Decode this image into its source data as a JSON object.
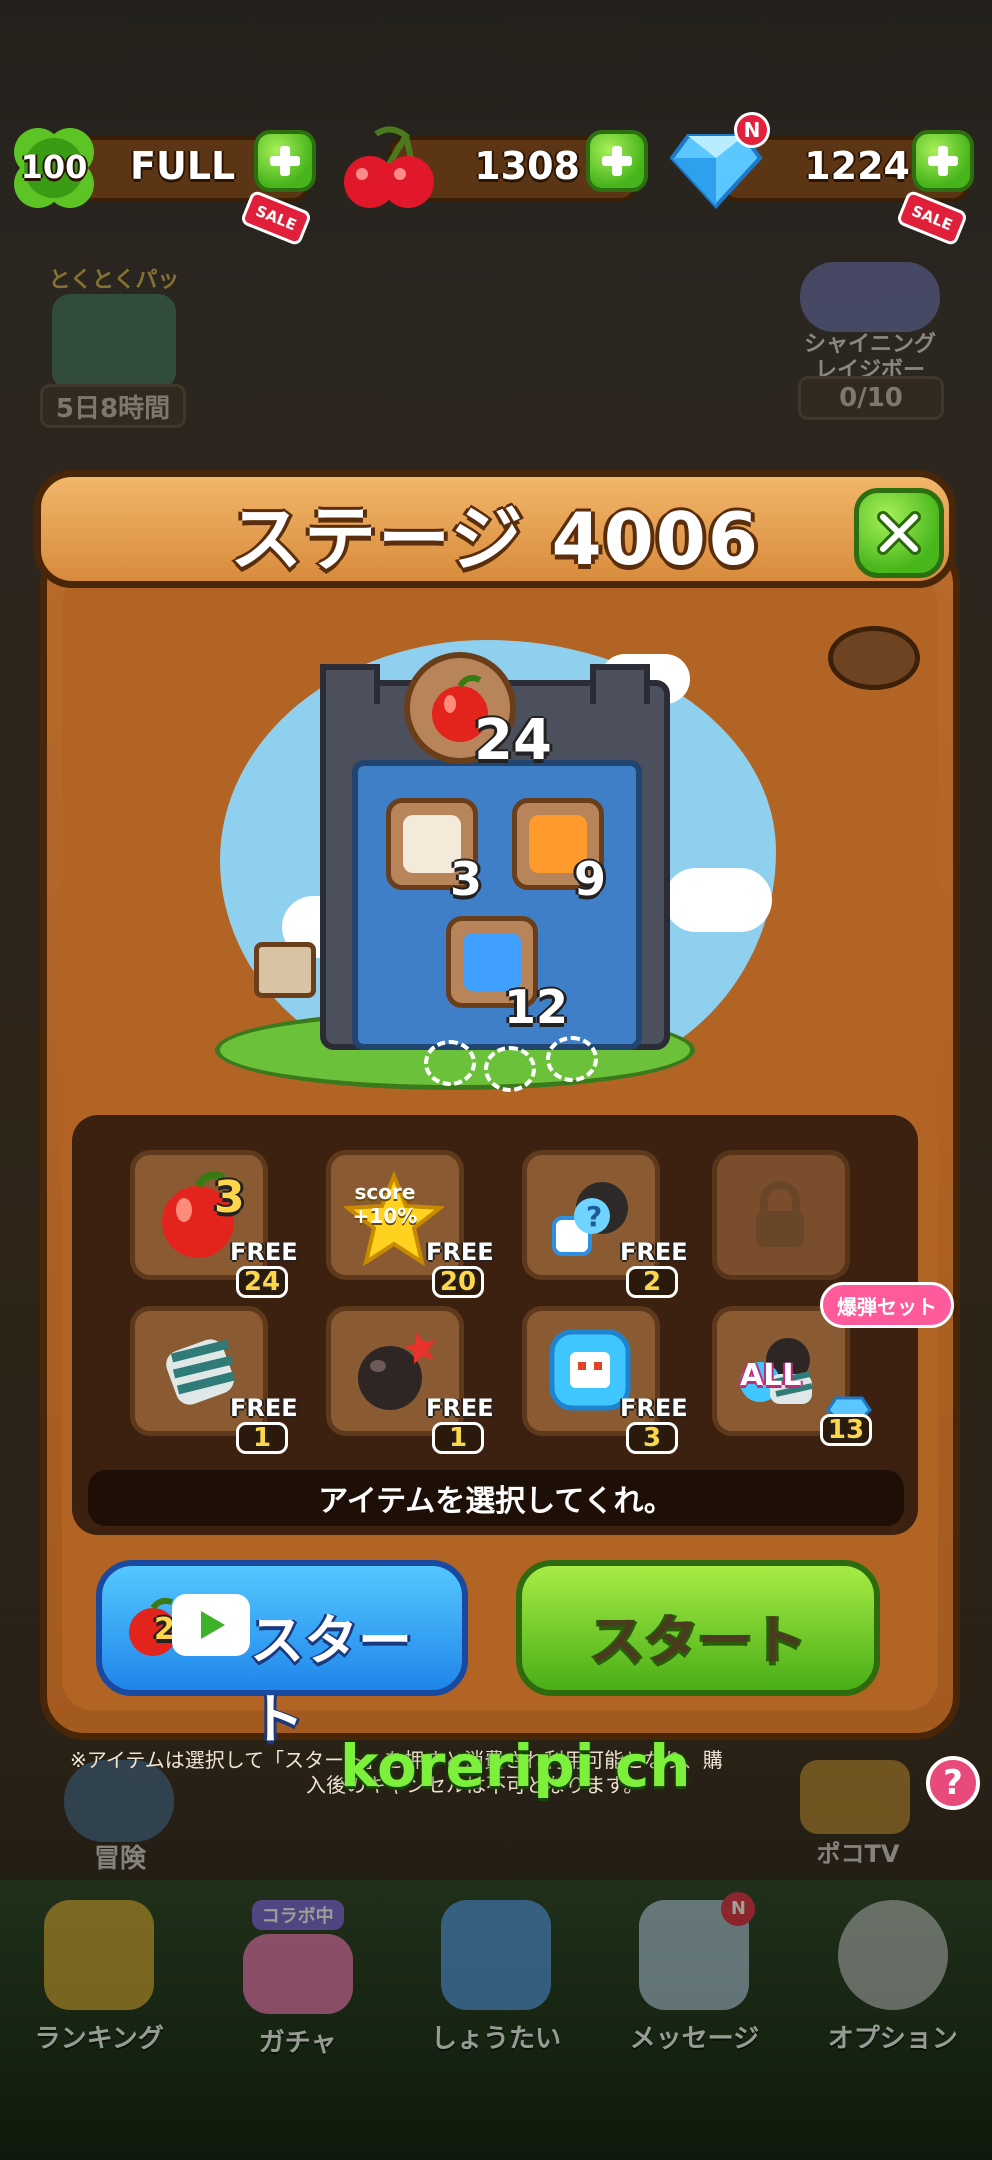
{
  "resources": {
    "lives": {
      "badge": "100",
      "value": "FULL",
      "sale": "SALE",
      "icon": "clover-icon"
    },
    "cherries": {
      "value": "1308",
      "icon": "cherry-icon"
    },
    "gems": {
      "value": "1224",
      "sale": "SALE",
      "new_badge": "N",
      "icon": "diamond-icon"
    }
  },
  "background": {
    "pack_title": "とくとくパック",
    "pack_timer": "5日8時間",
    "event_title_1": "シャイニング",
    "event_title_2": "レイジボー",
    "event_progress": "0/10",
    "adventure_label": "冒険"
  },
  "dialog": {
    "title": "ステージ 4006",
    "goal_main": "24",
    "goals": [
      {
        "count": "3",
        "color": "#f4ead9"
      },
      {
        "count": "9",
        "color": "#ff9a2c"
      },
      {
        "count": "12",
        "color": "#3fa0ff"
      }
    ],
    "items": [
      {
        "icon": "apple-icon",
        "free": "FREE",
        "count": "24",
        "badge": "3"
      },
      {
        "icon": "score-star-icon",
        "free": "FREE",
        "count": "20",
        "badge": "score +10%"
      },
      {
        "icon": "random-bomb-icon",
        "free": "FREE",
        "count": "2"
      },
      {
        "icon": "lock-icon"
      },
      {
        "icon": "striped-candy-icon",
        "free": "FREE",
        "count": "1"
      },
      {
        "icon": "bomb-icon",
        "free": "FREE",
        "count": "1"
      },
      {
        "icon": "blue-block-icon",
        "free": "FREE",
        "count": "3"
      },
      {
        "icon": "all-set-icon",
        "count": "13",
        "set_label": "爆弾セット",
        "all_label": "ALL"
      }
    ],
    "hint": "アイテムを選択してくれ。",
    "ad_start": {
      "label": "スタート",
      "count": "2"
    },
    "start": {
      "label": "スタート"
    },
    "note_line1": "※アイテムは選択して「スタート」を押すと消費され利用可能となり、購",
    "note_line2": "入後のキャンセルは不可となります。"
  },
  "watermark": "koreripi ch",
  "nav": [
    {
      "label": "ランキング",
      "icon": "trophy-icon"
    },
    {
      "label": "ガチャ",
      "icon": "gacha-icon",
      "badge": "コラボ中"
    },
    {
      "label": "しょうたい",
      "icon": "invite-icon"
    },
    {
      "label": "メッセージ",
      "icon": "mail-icon",
      "badge": "N"
    },
    {
      "label": "オプション",
      "icon": "gear-icon"
    }
  ],
  "pokotv_label": "ポコTV",
  "colors": {
    "accent_green": "#4aae17",
    "accent_blue": "#1f86ea",
    "panel_wood": "#b26424",
    "title_wood": "#e69b4a"
  }
}
